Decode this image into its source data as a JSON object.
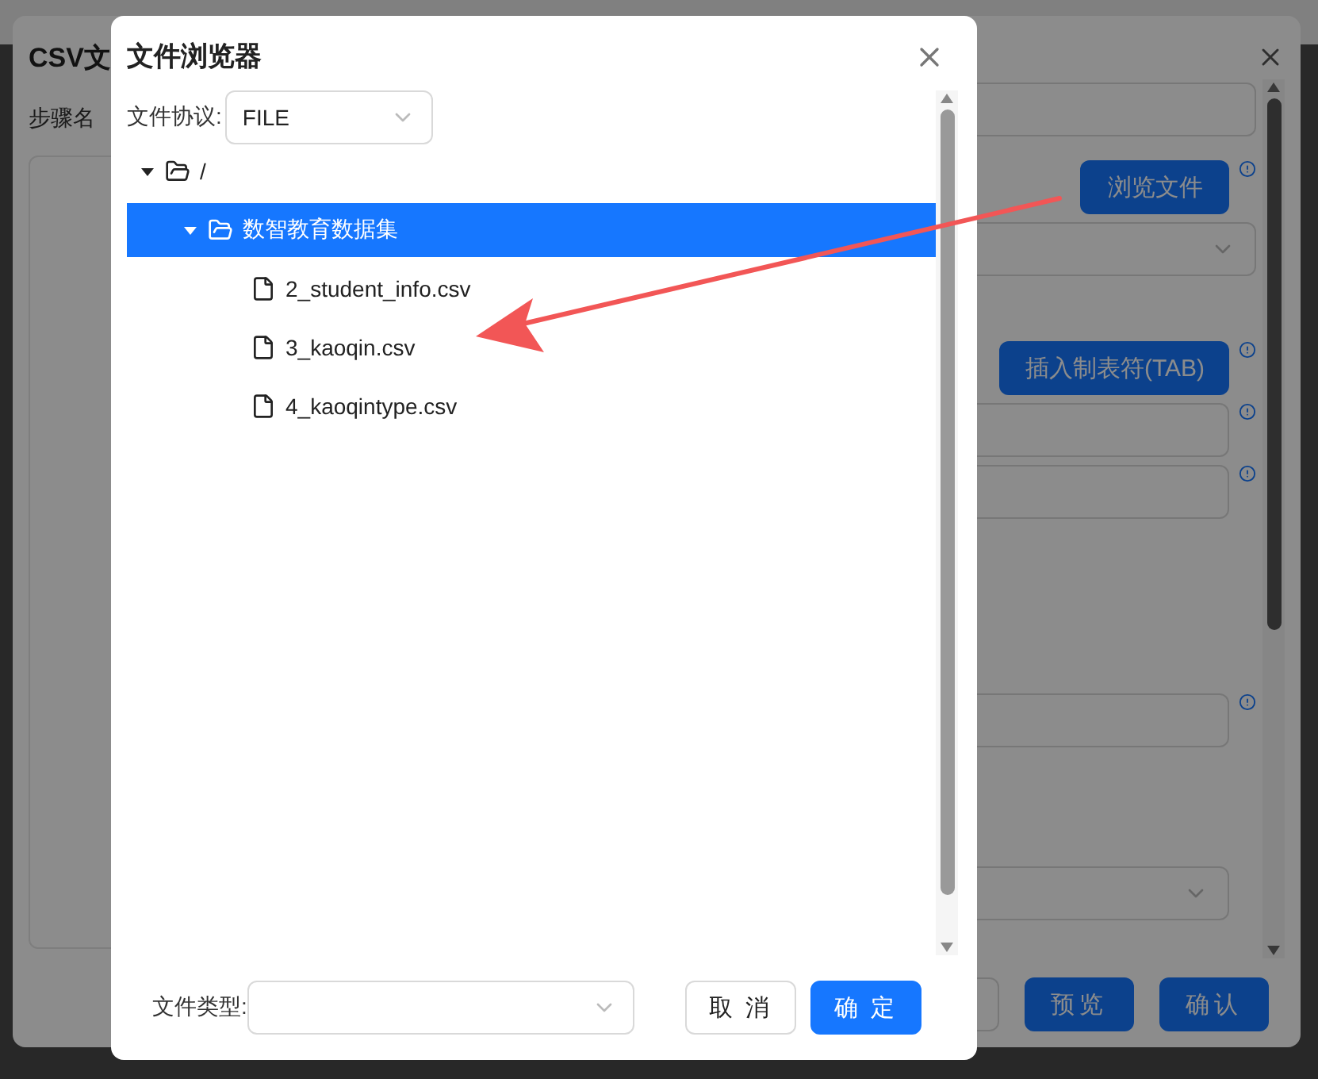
{
  "background_dialog": {
    "title": "CSV文",
    "step_name_label": "步骤名",
    "browse_button": "浏览文件",
    "tab_button": "插入制表符(TAB)",
    "buttons": [
      "预览",
      "确认"
    ]
  },
  "file_browser": {
    "title": "文件浏览器",
    "protocol": {
      "label": "文件协议:",
      "value": "FILE"
    },
    "tree": [
      {
        "label": "/",
        "kind": "folder",
        "expanded": true,
        "selected": false,
        "children": [
          {
            "label": "数智教育数据集",
            "kind": "folder",
            "expanded": true,
            "selected": true,
            "children": [
              {
                "label": "2_student_info.csv",
                "kind": "file",
                "selected": false
              },
              {
                "label": "3_kaoqin.csv",
                "kind": "file",
                "selected": false
              },
              {
                "label": "4_kaoqintype.csv",
                "kind": "file",
                "selected": false
              }
            ]
          }
        ]
      }
    ],
    "file_type": {
      "label": "文件类型:"
    },
    "buttons": [
      {
        "label": "取 消",
        "kind": "secondary"
      },
      {
        "label": "确 定",
        "kind": "primary"
      }
    ]
  }
}
